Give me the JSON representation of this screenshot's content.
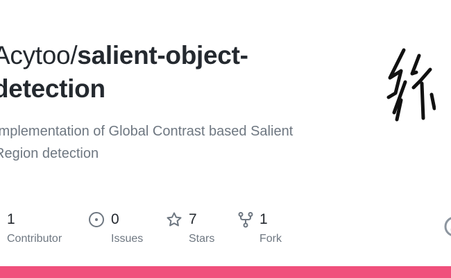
{
  "repo": {
    "owner": "Acytoo/",
    "name": "salient-object-detection",
    "description": "Implementation of Global Contrast based Salient Region detection"
  },
  "stats": [
    {
      "value": "1",
      "label": "Contributor",
      "icon": "people-icon"
    },
    {
      "value": "0",
      "label": "Issues",
      "icon": "issue-opened-icon"
    },
    {
      "value": "7",
      "label": "Stars",
      "icon": "star-icon"
    },
    {
      "value": "1",
      "label": "Fork",
      "icon": "repo-forked-icon"
    }
  ],
  "colors": {
    "text_primary": "#24292f",
    "text_secondary": "#6e7781",
    "accent_bar": "#f0507c"
  }
}
